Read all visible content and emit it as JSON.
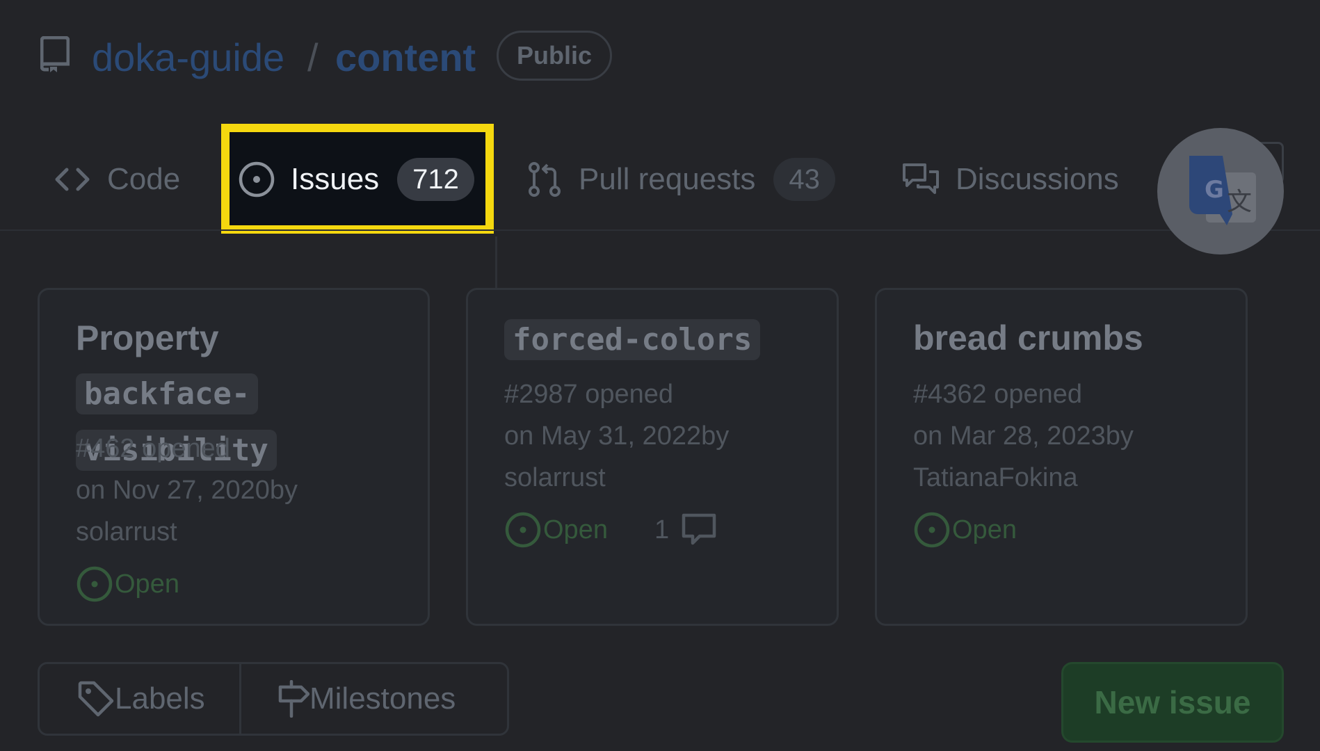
{
  "header": {
    "owner": "doka-guide",
    "separator": "/",
    "repo": "content",
    "visibility": "Public"
  },
  "tabs": [
    {
      "label": "Code",
      "icon": "code-icon"
    },
    {
      "label": "Issues",
      "count": "712",
      "icon": "issue-opened-icon",
      "selected": true
    },
    {
      "label": "Pull requests",
      "count": "43",
      "icon": "git-pull-request-icon"
    },
    {
      "label": "Discussions",
      "icon": "comment-discussion-icon"
    }
  ],
  "overlay": {
    "icon": "google-translate-icon"
  },
  "issues": [
    {
      "title_text": "Property",
      "title_code_1": "backface-",
      "title_code_2": "visibility",
      "number": "#462 opened",
      "opened_on": "on Nov 27, 2020by",
      "author": "solarrust",
      "status": "Open"
    },
    {
      "title_code": "forced-colors",
      "number": "#2987 opened",
      "opened_on": "on May 31, 2022by",
      "author": "solarrust",
      "status": "Open",
      "comments": "1"
    },
    {
      "title_text": "bread crumbs",
      "number": "#4362 opened",
      "opened_on": "on Mar 28, 2023by",
      "author": "TatianaFokina",
      "status": "Open"
    }
  ],
  "actions": {
    "labels": "Labels",
    "milestones": "Milestones",
    "new_issue": "New issue"
  },
  "colors": {
    "background": "#232428",
    "highlight_border": "#f5d80f",
    "link": "#2b4a77",
    "open_status": "#355a3c"
  }
}
